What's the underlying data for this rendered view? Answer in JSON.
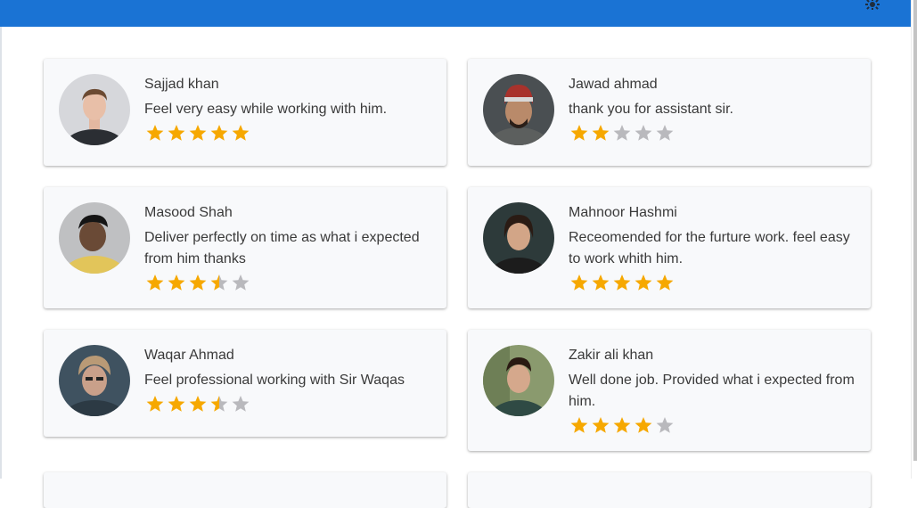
{
  "colors": {
    "header": "#1a73d4",
    "star_filled": "#f6a800",
    "star_empty": "#b9b9bd",
    "card_bg": "#f8f9fb"
  },
  "header": {
    "icon": "gear-icon"
  },
  "reviews": [
    {
      "name": "Sajjad khan",
      "comment": "Feel very easy while working with him.",
      "rating": 5
    },
    {
      "name": "Jawad ahmad",
      "comment": "thank you for assistant sir.",
      "rating": 2
    },
    {
      "name": "Masood Shah",
      "comment": "Deliver perfectly on time as what i expected from him thanks",
      "rating": 3.5
    },
    {
      "name": "Mahnoor Hashmi",
      "comment": "Receomended for the furture work. feel easy to work whith him.",
      "rating": 5
    },
    {
      "name": "Waqar Ahmad",
      "comment": "Feel professional working with Sir Waqas",
      "rating": 3.5
    },
    {
      "name": "Zakir ali khan",
      "comment": "Well done job. Provided what i expected from him.",
      "rating": 4
    }
  ]
}
